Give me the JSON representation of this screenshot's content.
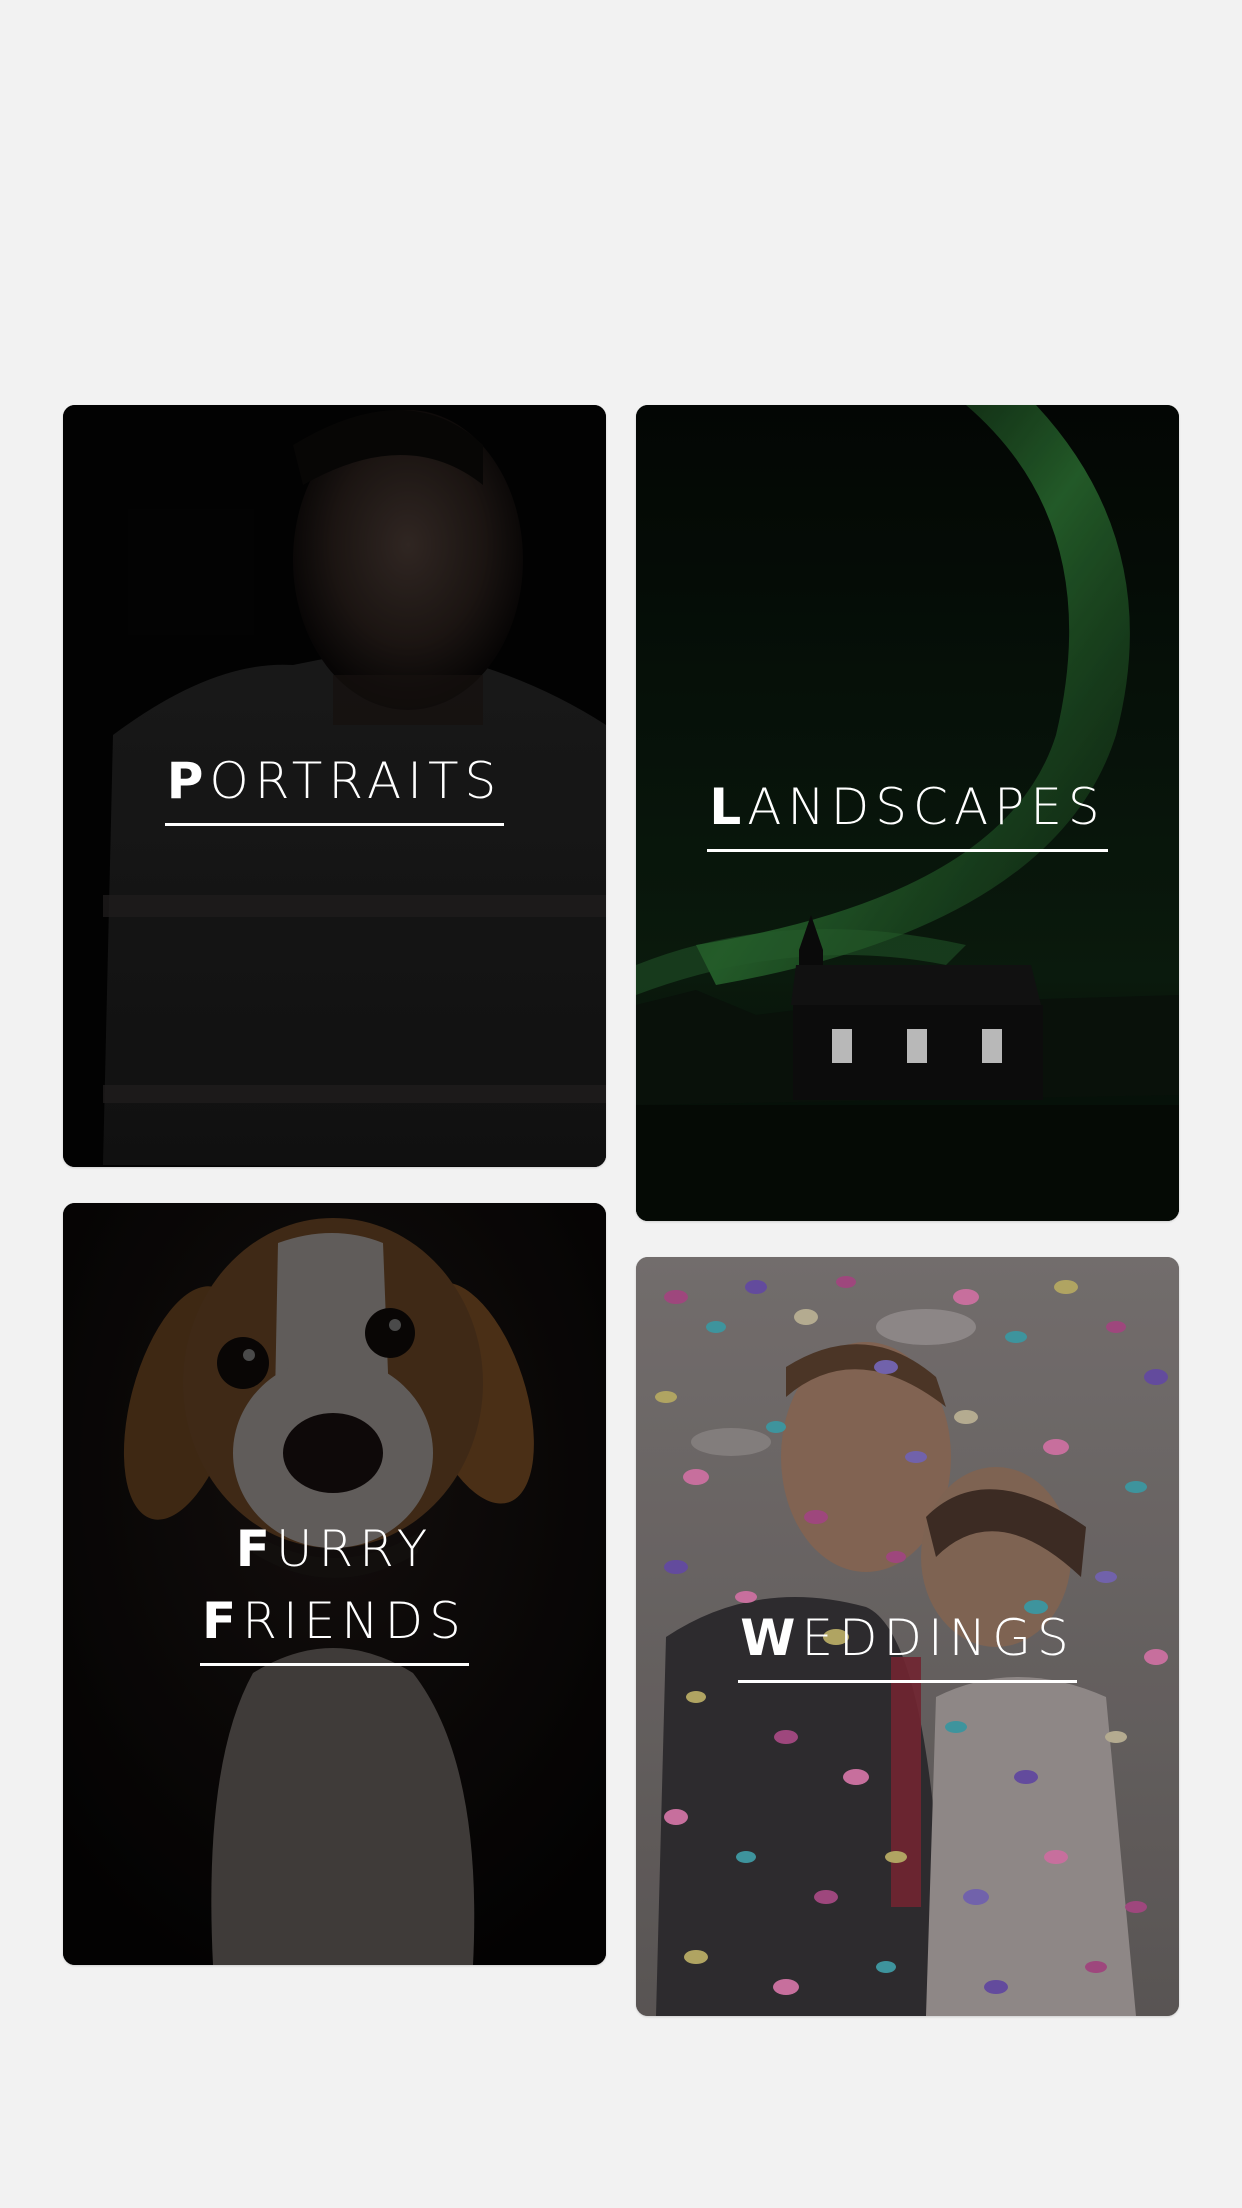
{
  "categories": [
    {
      "id": "portraits",
      "initial": "P",
      "rest": "ORTRAITS",
      "image": "portrait-man-in-sweater"
    },
    {
      "id": "landscapes",
      "initial": "L",
      "rest": "ANDSCAPES",
      "image": "northern-lights-over-black-church"
    },
    {
      "id": "furry",
      "line1_initial": "F",
      "line1_rest": "URRY",
      "line2_initial": "F",
      "line2_rest": "RIENDS",
      "image": "beagle-dog-portrait"
    },
    {
      "id": "weddings",
      "initial": "W",
      "rest": "EDDINGS",
      "image": "wedding-couple-confetti"
    }
  ],
  "colors": {
    "page_background": "#f2f2f2",
    "caption_text": "#ffffff"
  }
}
